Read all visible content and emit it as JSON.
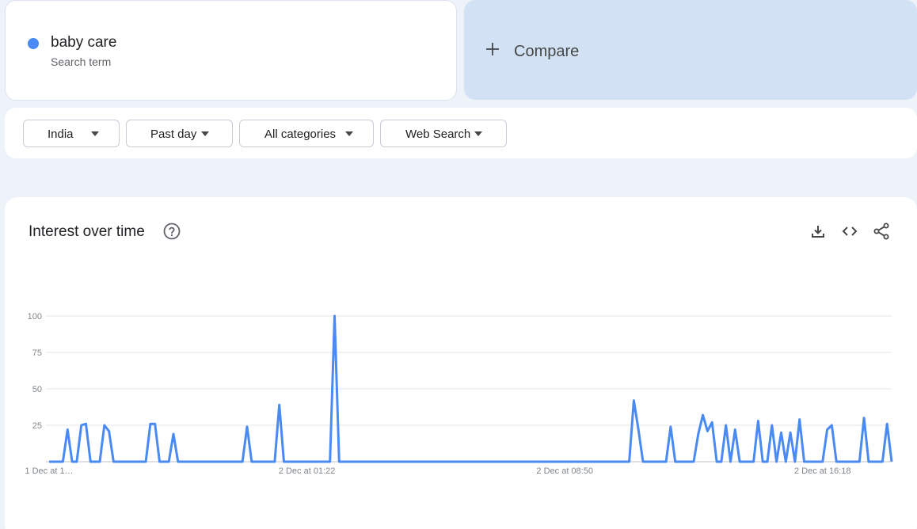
{
  "search_term": {
    "name": "baby care",
    "subtitle": "Search term",
    "color": "#4a8af4"
  },
  "compare": {
    "label": "Compare",
    "icon": "plus-icon"
  },
  "filters": [
    {
      "label": "India"
    },
    {
      "label": "Past day"
    },
    {
      "label": "All categories"
    },
    {
      "label": "Web Search"
    }
  ],
  "chart_card": {
    "title": "Interest over time",
    "help_icon": "help-circle-icon",
    "actions": [
      "download-icon",
      "embed-code-icon",
      "share-icon"
    ]
  },
  "chart_data": {
    "type": "line",
    "title": "Interest over time",
    "ylim": [
      0,
      100
    ],
    "y_ticks": [
      100,
      75,
      50,
      25
    ],
    "x_tick_labels": [
      "1 Dec at 1…",
      "2 Dec at 01:22",
      "2 Dec at 08:50",
      "2 Dec at 16:18"
    ],
    "x_tick_indices": [
      0,
      56,
      112,
      168
    ],
    "grid": true,
    "legend": false,
    "color": "#4a8af4",
    "series": [
      {
        "values": [
          0,
          0,
          0,
          0,
          22,
          0,
          0,
          25,
          26,
          0,
          0,
          0,
          25,
          21,
          0,
          0,
          0,
          0,
          0,
          0,
          0,
          0,
          26,
          26,
          0,
          0,
          0,
          19,
          0,
          0,
          0,
          0,
          0,
          0,
          0,
          0,
          0,
          0,
          0,
          0,
          0,
          0,
          0,
          24,
          0,
          0,
          0,
          0,
          0,
          0,
          39,
          0,
          0,
          0,
          0,
          0,
          0,
          0,
          0,
          0,
          0,
          0,
          100,
          0,
          0,
          0,
          0,
          0,
          0,
          0,
          0,
          0,
          0,
          0,
          0,
          0,
          0,
          0,
          0,
          0,
          0,
          0,
          0,
          0,
          0,
          0,
          0,
          0,
          0,
          0,
          0,
          0,
          0,
          0,
          0,
          0,
          0,
          0,
          0,
          0,
          0,
          0,
          0,
          0,
          0,
          0,
          0,
          0,
          0,
          0,
          0,
          0,
          0,
          0,
          0,
          0,
          0,
          0,
          0,
          0,
          0,
          0,
          0,
          0,
          0,
          0,
          0,
          42,
          22,
          0,
          0,
          0,
          0,
          0,
          0,
          24,
          0,
          0,
          0,
          0,
          0,
          19,
          32,
          21,
          27,
          0,
          0,
          25,
          0,
          22,
          0,
          0,
          0,
          0,
          28,
          0,
          0,
          25,
          0,
          20,
          0,
          20,
          0,
          29,
          0,
          0,
          0,
          0,
          0,
          22,
          25,
          0,
          0,
          0,
          0,
          0,
          0,
          30,
          0,
          0,
          0,
          0,
          26,
          0
        ]
      }
    ]
  }
}
